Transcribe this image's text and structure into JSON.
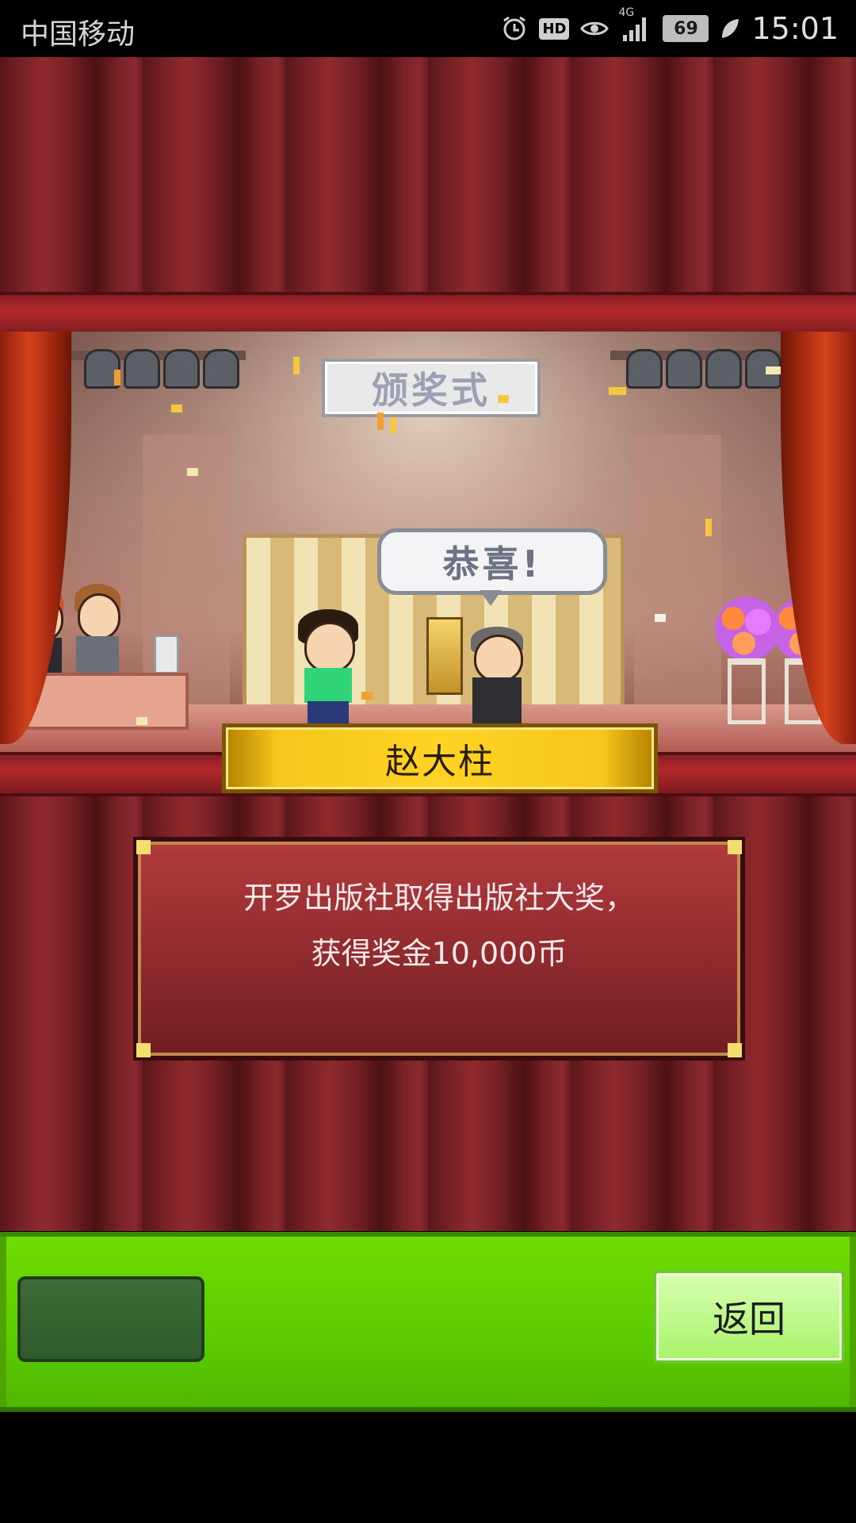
{
  "status_bar": {
    "carrier": "中国移动",
    "hd": "HD",
    "network": "4G",
    "battery": "69",
    "time": "15:01"
  },
  "stage": {
    "sign": "颁奖式",
    "speech": "恭喜!"
  },
  "winner_name": "赵大柱",
  "message": {
    "line1": "开罗出版社取得出版社大奖，",
    "line2": "获得奖金10,000币"
  },
  "bottom_bar": {
    "back_label": "返回"
  },
  "colors": {
    "curtain": "#7a2226",
    "gold": "#ffd324",
    "panel_green": "#5ccc00",
    "message_red": "#8e2a2e"
  }
}
